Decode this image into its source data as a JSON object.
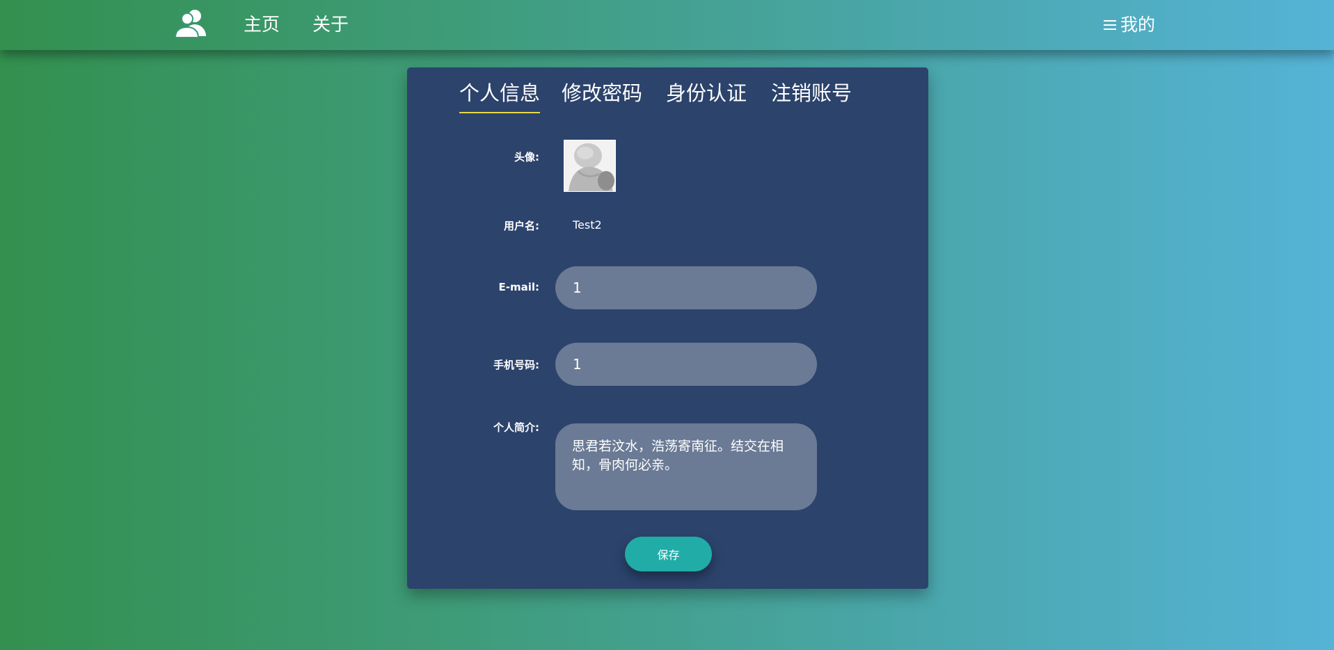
{
  "header": {
    "logo_icon": "users-icon",
    "nav": {
      "home_label": "主页",
      "about_label": "关于"
    },
    "mine_label": "我的",
    "mine_icon": "menu-icon"
  },
  "profile": {
    "tabs": [
      {
        "label": "个人信息",
        "active": true
      },
      {
        "label": "修改密码",
        "active": false
      },
      {
        "label": "身份认证",
        "active": false
      },
      {
        "label": "注销账号",
        "active": false
      }
    ],
    "fields": {
      "avatar_label": "头像:",
      "username_label": "用户名:",
      "username_value": "Test2",
      "email_label": "E-mail:",
      "email_value": "1",
      "phone_label": "手机号码:",
      "phone_value": "1",
      "bio_label": "个人简介:",
      "bio_value": "思君若汶水，浩荡寄南征。结交在相知，骨肉何必亲。"
    },
    "save_label": "保存"
  },
  "colors": {
    "panel_bg": "#2c436c",
    "input_bg": "#6b7a95",
    "save_button": "#21aca8",
    "active_tab_underline": "#e7d94a"
  }
}
